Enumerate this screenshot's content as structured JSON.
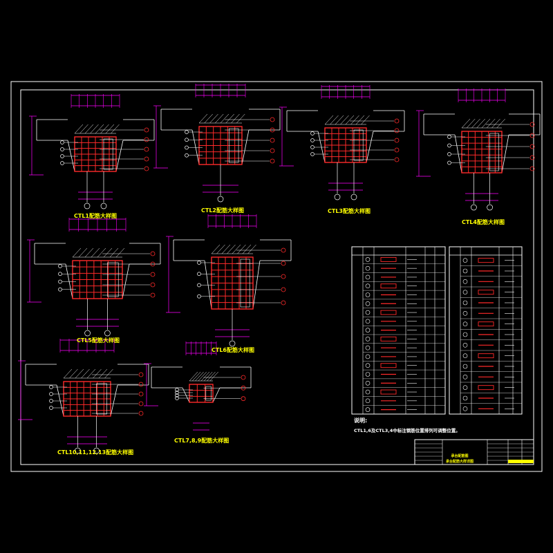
{
  "sheet": {
    "colors": {
      "background": "#000000",
      "frame": "#ffffff",
      "rebar": "#ff2a2a",
      "dimension": "#ff00ff",
      "leader": "#ffffff",
      "label": "#ffff00",
      "highlight": "#ffff00",
      "table_line": "#ffffff"
    }
  },
  "details": [
    {
      "id": "d1",
      "title": "CTL1配筋大样图"
    },
    {
      "id": "d2",
      "title": "CTL2配筋大样图"
    },
    {
      "id": "d3",
      "title": "CTL3配筋大样图"
    },
    {
      "id": "d4",
      "title": "CTL4配筋大样图"
    },
    {
      "id": "d5",
      "title": "CTL5配筋大样图"
    },
    {
      "id": "d6",
      "title": "CTL6配筋大样图"
    },
    {
      "id": "d7",
      "title": "CTL10,11,12,13配筋大样图"
    },
    {
      "id": "d8",
      "title": "CTL7,8,9配筋大样图"
    }
  ],
  "notes": {
    "heading": "说明:",
    "line1": "CTL1,6及CTL3,4中标注钢筋位置排列可调整位置。"
  },
  "title_block": {
    "drawing_name_1": "承台配筋图",
    "drawing_name_2": "承台配筋大样详图"
  }
}
